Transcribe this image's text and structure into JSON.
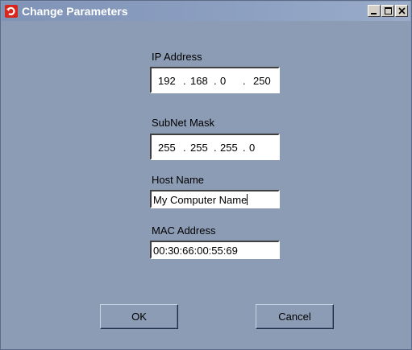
{
  "window": {
    "title": "Change Parameters",
    "controls": {
      "minimize_icon": "minimize-icon",
      "maximize_icon": "maximize-icon",
      "close_icon": "close-icon"
    }
  },
  "form": {
    "ip": {
      "label": "IP Address",
      "octets": [
        "192",
        "168",
        "0",
        "250"
      ],
      "separator": "."
    },
    "subnet": {
      "label": "SubNet Mask",
      "octets": [
        "255",
        "255",
        "255",
        "0"
      ],
      "separator": "."
    },
    "host": {
      "label": "Host Name",
      "value": "My Computer Name"
    },
    "mac": {
      "label": "MAC Address",
      "value": "00:30:66:00:55:69"
    }
  },
  "buttons": {
    "ok": "OK",
    "cancel": "Cancel"
  },
  "colors": {
    "window_background": "#8c9cb5",
    "title_text": "#ffffff",
    "app_icon": "#d9261c"
  }
}
